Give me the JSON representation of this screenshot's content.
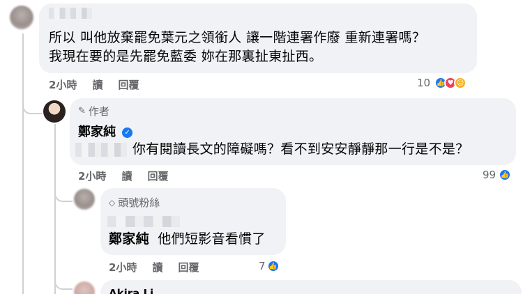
{
  "comment1": {
    "text_line1": "所以 叫他放棄罷免葉元之領銜人 讓一階連署作廢 重新連署嗎？",
    "text_line2": "我現在要的是先罷免藍委 妳在那裏扯東扯西。",
    "time": "2小時",
    "reply_action": "讀",
    "reply_label": "回覆",
    "reaction_count": "10"
  },
  "comment2": {
    "badge": "作者",
    "author": "鄭家純",
    "text": "你有閱讀長文的障礙嗎？看不到安安靜靜那一行是不是？",
    "time": "2小時",
    "reply_action": "讀",
    "reply_label": "回覆",
    "reaction_count": "99"
  },
  "comment3": {
    "badge": "頭號粉絲",
    "mention": "鄭家純",
    "text": "他們短影音看慣了",
    "time": "2小時",
    "reply_action": "讀",
    "reply_label": "回覆",
    "reaction_count": "7"
  },
  "comment4": {
    "author": "Akira Li"
  },
  "icons": [
    "pencil-icon",
    "verified-icon",
    "diamond-icon",
    "like-icon",
    "love-icon",
    "sad-icon"
  ],
  "colors": {
    "accent": "#1877f2",
    "bubble": "#f0f2f5",
    "meta": "#65676b"
  }
}
